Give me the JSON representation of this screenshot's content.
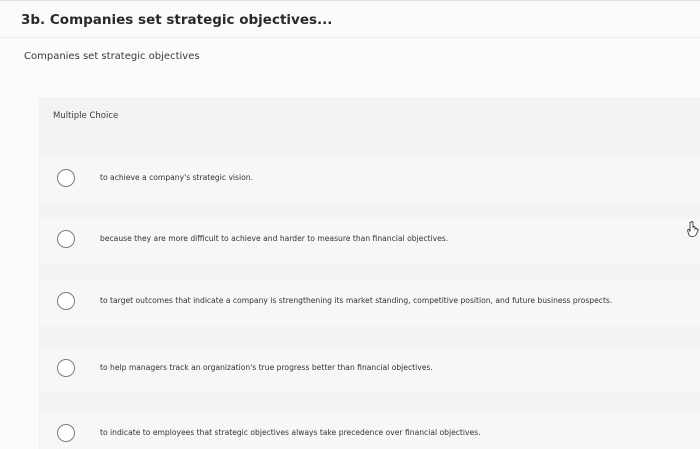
{
  "question": {
    "title": "3b. Companies set strategic objectives...",
    "prompt": "Companies set strategic objectives",
    "type_label": "Multiple Choice"
  },
  "options": [
    {
      "text": "to achieve a company's strategic vision."
    },
    {
      "text": "because they are more difficult to achieve and harder to measure than financial objectives."
    },
    {
      "text": "to target outcomes that indicate a company is strengthening its market standing, competitive position, and future business prospects."
    },
    {
      "text": "to help managers track an organization's true progress better than financial objectives."
    },
    {
      "text": "to indicate to employees that strategic objectives always take precedence over financial objectives."
    }
  ]
}
